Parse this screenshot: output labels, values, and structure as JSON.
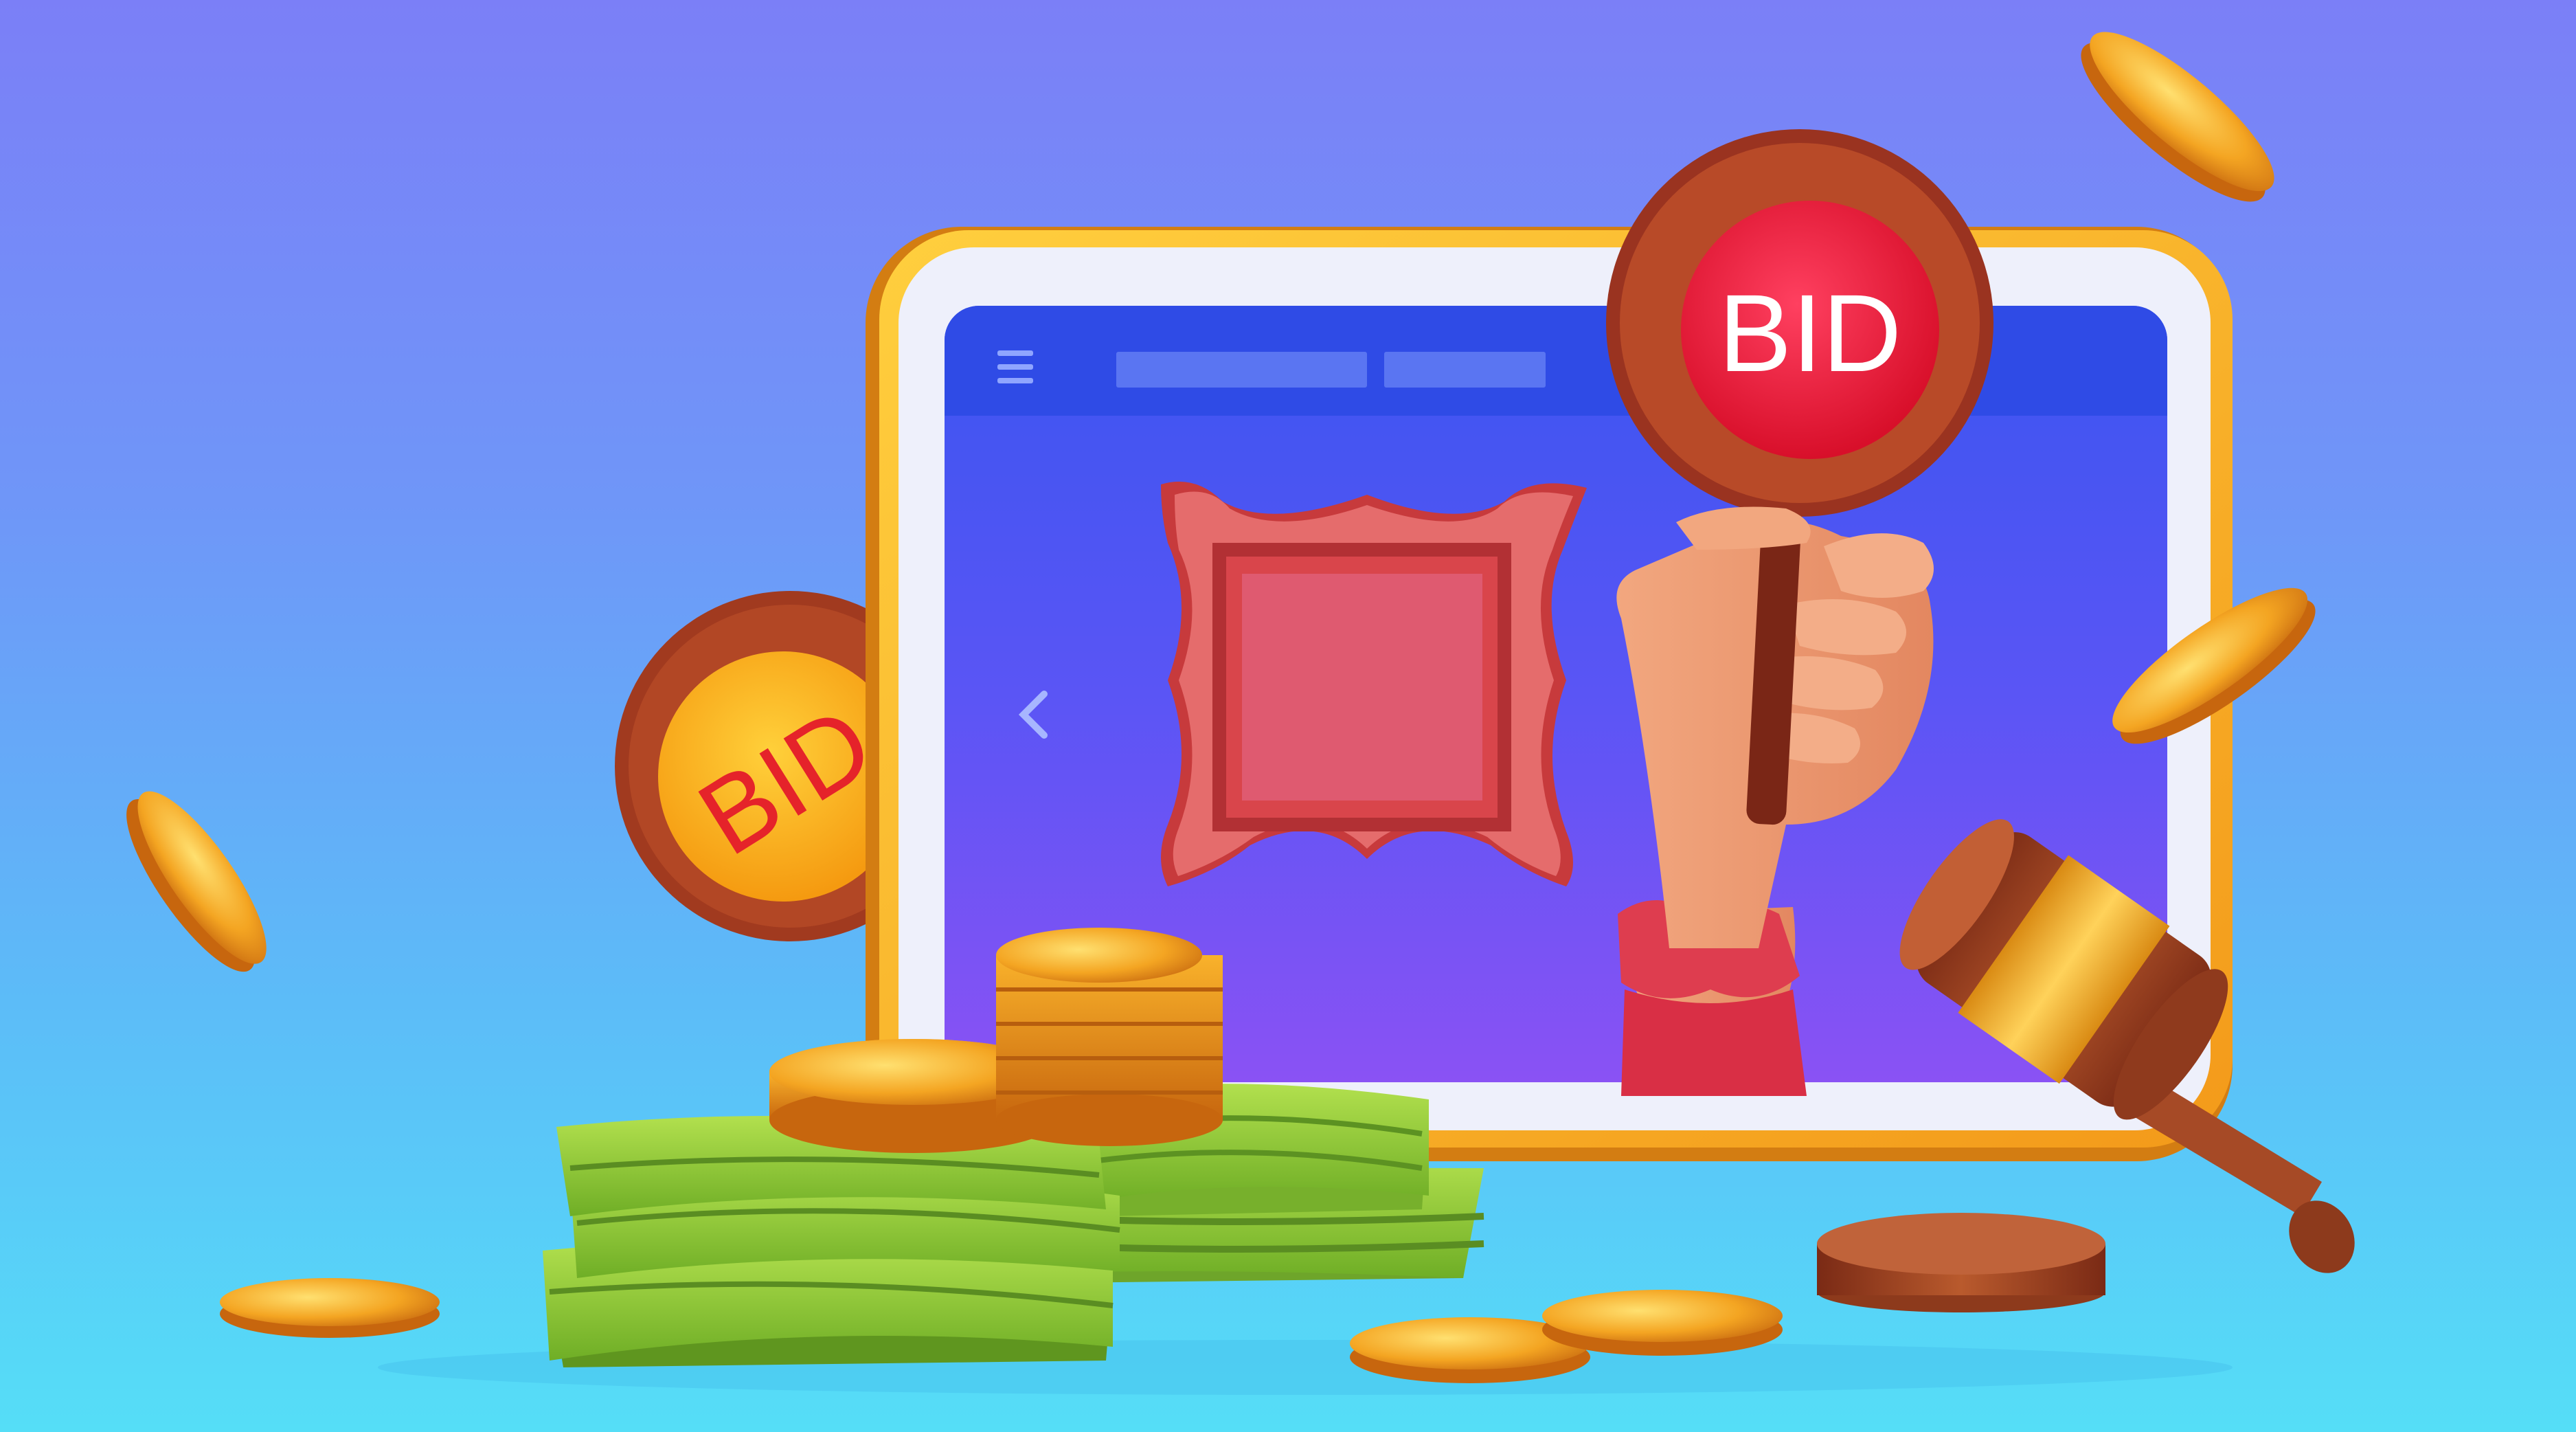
{
  "scene": {
    "paddles": [
      {
        "label": "BID",
        "color": "#ee1837",
        "position": "held-by-hand"
      },
      {
        "label": "BID",
        "color": "#fdb51a",
        "position": "left-of-tablet"
      }
    ],
    "tablet": {
      "menu_icon": "hamburger-menu-icon",
      "nav_icon": "chevron-left-icon",
      "screen_content": "empty-ornate-picture-frame"
    },
    "objects": [
      "bid-paddle",
      "picture-frame",
      "gavel",
      "sound-block",
      "banknote-stacks",
      "gold-coin-stacks",
      "falling-coins"
    ],
    "colors": {
      "background_top": "#7b7ff7",
      "background_bottom": "#55def7",
      "tablet_frame": "#f6a51d",
      "screen": "#4a5cf3",
      "bid_paddle_red": "#ee1837",
      "bid_paddle_yellow": "#fdb51a",
      "money": "#8fcf36",
      "coin": "#f2a41f",
      "gavel": "#a64a26"
    }
  }
}
